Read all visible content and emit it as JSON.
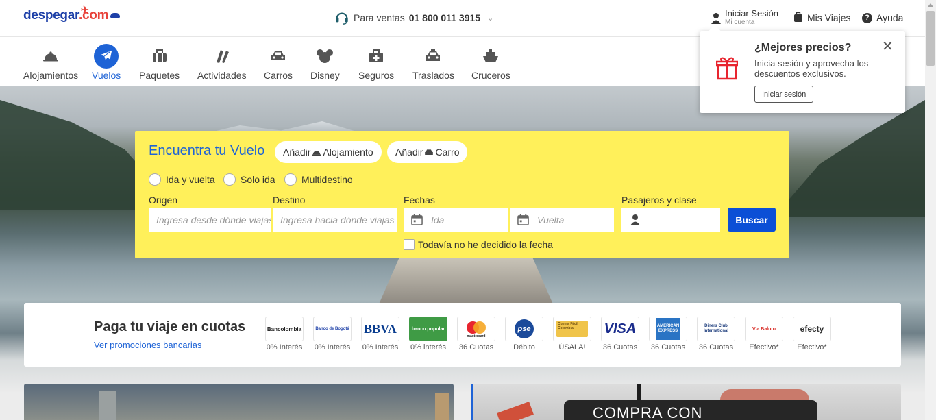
{
  "header": {
    "logo_text": "despegar",
    "logo_dot": ".com",
    "sales_label": "Para ventas",
    "sales_phone": "01 800 011 3915",
    "login_label": "Iniciar Sesión",
    "login_sub": "Mi cuenta",
    "trips_label": "Mis Viajes",
    "help_label": "Ayuda"
  },
  "products": [
    {
      "label": "Alojamientos",
      "icon": "cloche-icon"
    },
    {
      "label": "Vuelos",
      "icon": "plane-icon",
      "active": true
    },
    {
      "label": "Paquetes",
      "icon": "suitcase-icon"
    },
    {
      "label": "Actividades",
      "icon": "tickets-icon"
    },
    {
      "label": "Carros",
      "icon": "car-icon"
    },
    {
      "label": "Disney",
      "icon": "mouse-ears-icon"
    },
    {
      "label": "Seguros",
      "icon": "medkit-icon"
    },
    {
      "label": "Traslados",
      "icon": "taxi-icon"
    },
    {
      "label": "Cruceros",
      "icon": "ship-icon"
    }
  ],
  "popup": {
    "title": "¿Mejores precios?",
    "text": "Inicia sesión y aprovecha los descuentos exclusivos.",
    "button": "Iniciar sesión"
  },
  "search": {
    "title": "Encuentra tu Vuelo",
    "add_prefix": "Añadir",
    "add_hotel": "Alojamiento",
    "add_car": "Carro",
    "trip_types": [
      "Ida y vuelta",
      "Solo ida",
      "Multidestino"
    ],
    "origin_label": "Origen",
    "origin_placeholder": "Ingresa desde dónde viajas",
    "destination_label": "Destino",
    "destination_placeholder": "Ingresa hacia dónde viajas",
    "dates_label": "Fechas",
    "depart_placeholder": "Ida",
    "return_placeholder": "Vuelta",
    "passengers_label": "Pasajeros y clase",
    "search_button": "Buscar",
    "undecided_label": "Todavía no he decidido la fecha"
  },
  "payments": {
    "title": "Paga tu viaje en cuotas",
    "link": "Ver promociones bancarias",
    "methods": [
      {
        "name": "Bancolombia",
        "caption": "0% Interés"
      },
      {
        "name": "Banco de Bogotá",
        "caption": "0% Interés"
      },
      {
        "name": "BBVA",
        "caption": "0% Interés"
      },
      {
        "name": "banco popular",
        "caption": "0% interés"
      },
      {
        "name": "mastercard",
        "caption": "36 Cuotas"
      },
      {
        "name": "pse",
        "caption": "Débito"
      },
      {
        "name": "Cuenta Fácil Colombia",
        "caption": "ÚSALA!"
      },
      {
        "name": "VISA",
        "caption": "36 Cuotas"
      },
      {
        "name": "AMERICAN EXPRESS",
        "caption": "36 Cuotas"
      },
      {
        "name": "Diners Club International",
        "caption": "36 Cuotas"
      },
      {
        "name": "Via Baloto",
        "caption": "Efectivo*"
      },
      {
        "name": "efecty",
        "caption": "Efectivo*"
      }
    ]
  },
  "promos": {
    "mastercard_text": "COMPRA CON MASTERCARD"
  },
  "colors": {
    "brand_blue": "#1e63d6",
    "search_yellow": "#fff05a",
    "button_blue": "#0b4fd6"
  }
}
